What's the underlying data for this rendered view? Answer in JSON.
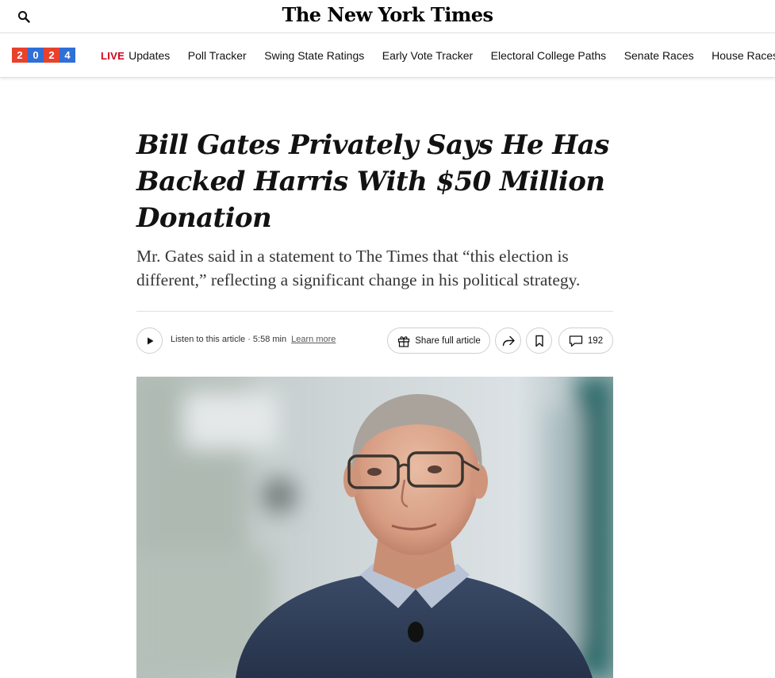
{
  "masthead": {
    "logo": "The New York Times",
    "search_icon": "search-icon"
  },
  "election_nav": {
    "year_digits": [
      {
        "digit": "2",
        "color": "#e8412c"
      },
      {
        "digit": "0",
        "color": "#2f6fd6"
      },
      {
        "digit": "2",
        "color": "#e8412c"
      },
      {
        "digit": "4",
        "color": "#2f6fd6"
      }
    ],
    "live_label": "LIVE",
    "items": [
      "Updates",
      "Poll Tracker",
      "Swing State Ratings",
      "Early Vote Tracker",
      "Electoral College Paths",
      "Senate Races",
      "House Races"
    ]
  },
  "article": {
    "headline": "Bill Gates Privately Says He Has Backed Harris With $50 Million Donation",
    "summary": "Mr. Gates said in a statement to The Times that “this election is different,” reflecting a significant change in his political strategy.",
    "listen_text": "Listen to this article · 5:58 min",
    "learn_more": "Learn more",
    "share_full_article": "Share full article",
    "comment_count": "192"
  },
  "colors": {
    "live": "#d0021b",
    "text": "#121212"
  }
}
